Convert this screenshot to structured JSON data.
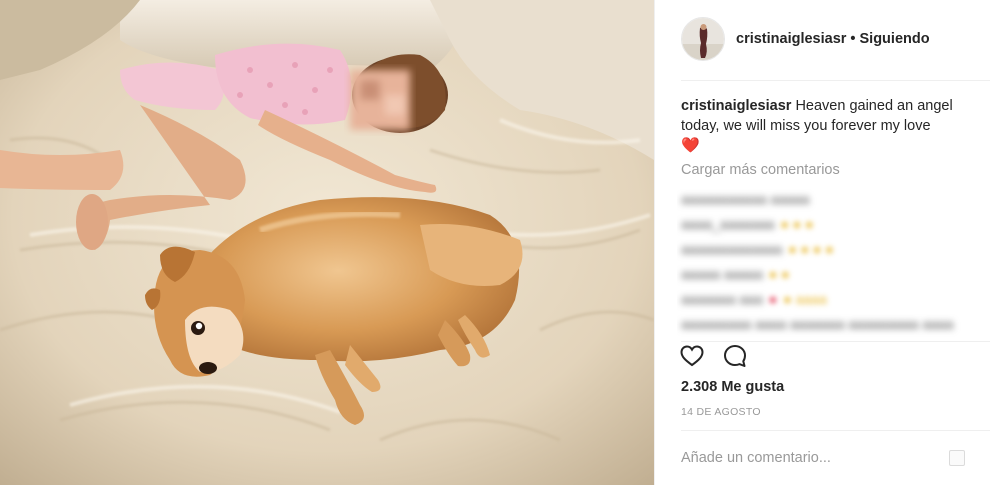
{
  "post": {
    "username": "cristinaiglesiasr",
    "separator": "•",
    "follow_status": "Siguiendo"
  },
  "caption": {
    "username": "cristinaiglesiasr",
    "text": "Heaven gained an angel today, we will miss you forever my love",
    "emoji": "❤️"
  },
  "comments": {
    "load_more": "Cargar más comentarios",
    "blurred": true
  },
  "actions": {
    "like_icon": "heart-outline-icon",
    "comment_icon": "comment-bubble-icon"
  },
  "likes": "2.308 Me gusta",
  "date": "14 DE AGOSTO",
  "add_comment": {
    "placeholder": "Añade un comentario..."
  }
}
